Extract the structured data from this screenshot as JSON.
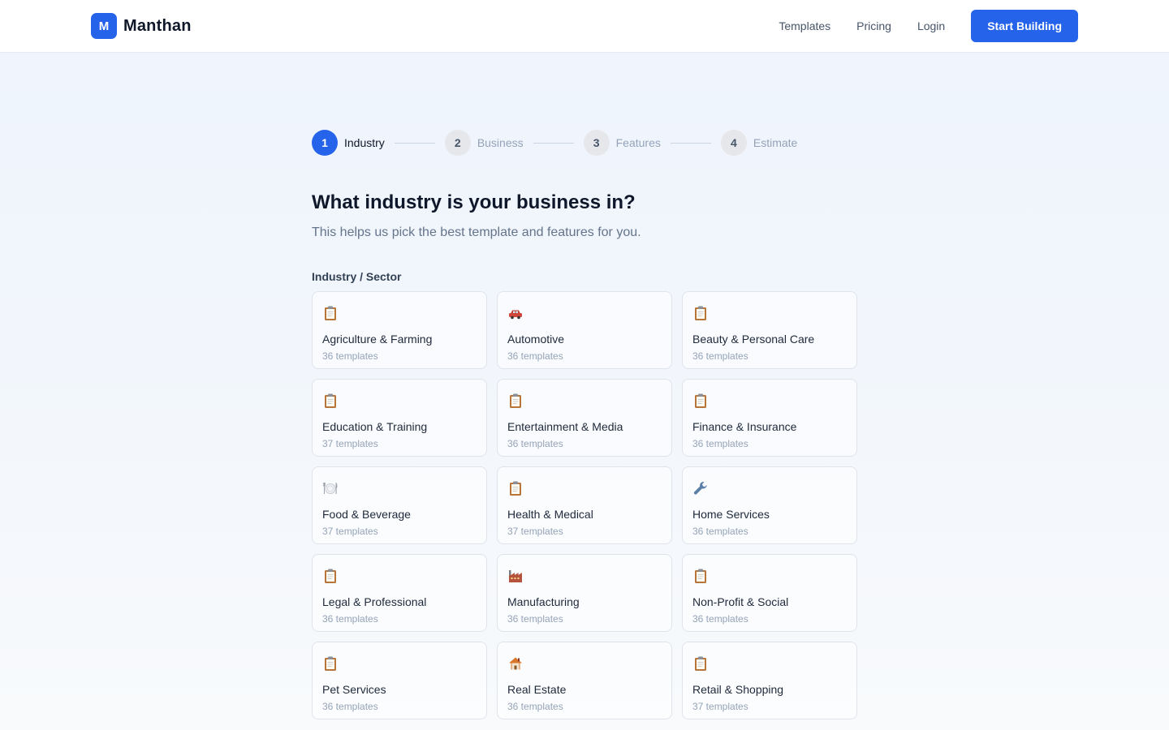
{
  "header": {
    "brand_mark": "M",
    "brand_name": "Manthan",
    "nav": [
      "Templates",
      "Pricing",
      "Login"
    ],
    "cta": "Start Building"
  },
  "stepper": [
    {
      "num": "1",
      "label": "Industry",
      "active": true
    },
    {
      "num": "2",
      "label": "Business",
      "active": false
    },
    {
      "num": "3",
      "label": "Features",
      "active": false
    },
    {
      "num": "4",
      "label": "Estimate",
      "active": false
    }
  ],
  "page": {
    "title": "What industry is your business in?",
    "subtitle": "This helps us pick the best template and features for you.",
    "section_label": "Industry / Sector"
  },
  "industries": [
    {
      "name": "Agriculture & Farming",
      "count": "36 templates",
      "icon": "clipboard-icon"
    },
    {
      "name": "Automotive",
      "count": "36 templates",
      "icon": "car-icon"
    },
    {
      "name": "Beauty & Personal Care",
      "count": "36 templates",
      "icon": "clipboard-icon"
    },
    {
      "name": "Education & Training",
      "count": "37 templates",
      "icon": "clipboard-icon"
    },
    {
      "name": "Entertainment & Media",
      "count": "36 templates",
      "icon": "clipboard-icon"
    },
    {
      "name": "Finance & Insurance",
      "count": "36 templates",
      "icon": "clipboard-icon"
    },
    {
      "name": "Food & Beverage",
      "count": "37 templates",
      "icon": "plate-icon"
    },
    {
      "name": "Health & Medical",
      "count": "37 templates",
      "icon": "clipboard-icon"
    },
    {
      "name": "Home Services",
      "count": "36 templates",
      "icon": "wrench-icon"
    },
    {
      "name": "Legal & Professional",
      "count": "36 templates",
      "icon": "clipboard-icon"
    },
    {
      "name": "Manufacturing",
      "count": "36 templates",
      "icon": "factory-icon"
    },
    {
      "name": "Non-Profit & Social",
      "count": "36 templates",
      "icon": "clipboard-icon"
    },
    {
      "name": "Pet Services",
      "count": "36 templates",
      "icon": "clipboard-icon"
    },
    {
      "name": "Real Estate",
      "count": "36 templates",
      "icon": "house-icon"
    },
    {
      "name": "Retail & Shopping",
      "count": "37 templates",
      "icon": "clipboard-icon"
    }
  ],
  "colors": {
    "accent": "#2563eb",
    "text_primary": "#0f172a",
    "text_muted": "#94a3b8"
  }
}
